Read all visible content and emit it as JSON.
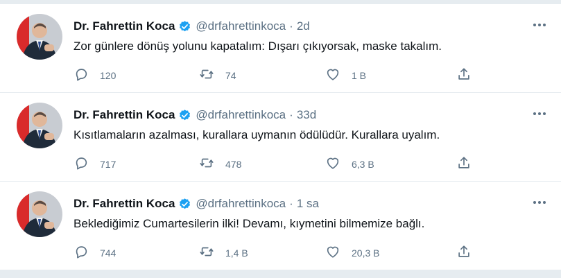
{
  "tweets": [
    {
      "name": "Dr. Fahrettin Koca",
      "handle": "@drfahrettinkoca",
      "separator": "·",
      "time": "2d",
      "text": "Zor günlere dönüş yolunu kapatalım: Dışarı çıkıyorsak, maske takalım.",
      "replies": "120",
      "retweets": "74",
      "likes": "1 B"
    },
    {
      "name": "Dr. Fahrettin Koca",
      "handle": "@drfahrettinkoca",
      "separator": "·",
      "time": "33d",
      "text": "Kısıtlamaların azalması, kurallara uymanın ödülüdür. Kurallara uyalım.",
      "replies": "717",
      "retweets": "478",
      "likes": "6,3 B"
    },
    {
      "name": "Dr. Fahrettin Koca",
      "handle": "@drfahrettinkoca",
      "separator": "·",
      "time": "1 sa",
      "text": "Beklediğimiz Cumartesilerin ilki! Devamı, kıymetini bilmemize bağlı.",
      "replies": "744",
      "retweets": "1,4 B",
      "likes": "20,3 B"
    }
  ],
  "icons": {
    "verified": "verified-badge-icon",
    "more": "more-options-icon",
    "reply": "reply-icon",
    "retweet": "retweet-icon",
    "like": "heart-icon",
    "share": "share-icon"
  },
  "colors": {
    "accent": "#1da1f2",
    "muted": "#5b7083",
    "divider": "#e6ecf0"
  }
}
